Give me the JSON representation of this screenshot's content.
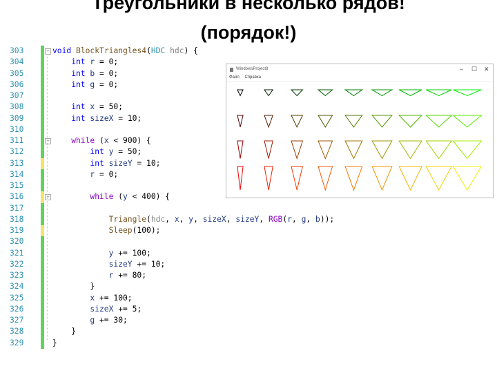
{
  "slide": {
    "title_line1": "Треугольники в несколько рядов!",
    "title_line2": "(порядок!)"
  },
  "editor": {
    "lines": [
      {
        "n": "303",
        "mark": "green",
        "fold": true,
        "indent": 0,
        "tokens": [
          [
            "void",
            "kw"
          ],
          [
            " ",
            "pl"
          ],
          [
            "BlockTriangles4",
            "fn"
          ],
          [
            "(",
            "pl"
          ],
          [
            "HDC",
            "ty"
          ],
          [
            " ",
            "pl"
          ],
          [
            "hdc",
            "par"
          ],
          [
            ") {",
            "pl"
          ]
        ]
      },
      {
        "n": "304",
        "mark": "green",
        "indent": 4,
        "tokens": [
          [
            "int",
            "kw"
          ],
          [
            " ",
            "pl"
          ],
          [
            "r",
            "var"
          ],
          [
            " = 0;",
            "pl"
          ]
        ]
      },
      {
        "n": "305",
        "mark": "green",
        "indent": 4,
        "tokens": [
          [
            "int",
            "kw"
          ],
          [
            " ",
            "pl"
          ],
          [
            "b",
            "var"
          ],
          [
            " = 0;",
            "pl"
          ]
        ]
      },
      {
        "n": "306",
        "mark": "green",
        "indent": 4,
        "tokens": [
          [
            "int",
            "kw"
          ],
          [
            " ",
            "pl"
          ],
          [
            "g",
            "var"
          ],
          [
            " = 0;",
            "pl"
          ]
        ]
      },
      {
        "n": "307",
        "mark": "green",
        "indent": 0,
        "tokens": []
      },
      {
        "n": "308",
        "mark": "green",
        "indent": 4,
        "tokens": [
          [
            "int",
            "kw"
          ],
          [
            " ",
            "pl"
          ],
          [
            "x",
            "var"
          ],
          [
            " = 50;",
            "pl"
          ]
        ]
      },
      {
        "n": "309",
        "mark": "green",
        "indent": 4,
        "tokens": [
          [
            "int",
            "kw"
          ],
          [
            " ",
            "pl"
          ],
          [
            "sizeX",
            "var"
          ],
          [
            " = 10;",
            "pl"
          ]
        ]
      },
      {
        "n": "310",
        "mark": "green",
        "indent": 0,
        "tokens": []
      },
      {
        "n": "311",
        "mark": "green",
        "fold": true,
        "indent": 4,
        "tokens": [
          [
            "while",
            "ctl"
          ],
          [
            " (",
            "pl"
          ],
          [
            "x",
            "var"
          ],
          [
            " < 900) {",
            "pl"
          ]
        ]
      },
      {
        "n": "312",
        "mark": "green",
        "indent": 8,
        "tokens": [
          [
            "int",
            "kw"
          ],
          [
            " ",
            "pl"
          ],
          [
            "y",
            "var"
          ],
          [
            " = 50;",
            "pl"
          ]
        ]
      },
      {
        "n": "313",
        "mark": "yellow",
        "indent": 8,
        "tokens": [
          [
            "int",
            "kw"
          ],
          [
            " ",
            "pl"
          ],
          [
            "sizeY",
            "var"
          ],
          [
            " = 10;",
            "pl"
          ]
        ]
      },
      {
        "n": "314",
        "mark": "green",
        "indent": 8,
        "tokens": [
          [
            "r",
            "var"
          ],
          [
            " = 0;",
            "pl"
          ]
        ]
      },
      {
        "n": "315",
        "mark": "green",
        "indent": 0,
        "tokens": []
      },
      {
        "n": "316",
        "mark": "yellow",
        "fold": true,
        "indent": 8,
        "tokens": [
          [
            "while",
            "ctl"
          ],
          [
            " (",
            "pl"
          ],
          [
            "y",
            "var"
          ],
          [
            " < 400) {",
            "pl"
          ]
        ]
      },
      {
        "n": "317",
        "mark": "green",
        "indent": 0,
        "tokens": []
      },
      {
        "n": "318",
        "mark": "green",
        "indent": 12,
        "tokens": [
          [
            "Triangle",
            "fn"
          ],
          [
            "(",
            "pl"
          ],
          [
            "hdc",
            "par"
          ],
          [
            ", ",
            "pl"
          ],
          [
            "x",
            "var"
          ],
          [
            ", ",
            "pl"
          ],
          [
            "y",
            "var"
          ],
          [
            ", ",
            "pl"
          ],
          [
            "sizeX",
            "var"
          ],
          [
            ", ",
            "pl"
          ],
          [
            "sizeY",
            "var"
          ],
          [
            ", ",
            "pl"
          ],
          [
            "RGB",
            "ctl"
          ],
          [
            "(",
            "pl"
          ],
          [
            "r",
            "var"
          ],
          [
            ", ",
            "pl"
          ],
          [
            "g",
            "var"
          ],
          [
            ", ",
            "pl"
          ],
          [
            "b",
            "var"
          ],
          [
            "));",
            "pl"
          ]
        ]
      },
      {
        "n": "319",
        "mark": "yellow",
        "indent": 12,
        "tokens": [
          [
            "Sleep",
            "fn"
          ],
          [
            "(100);",
            "pl"
          ]
        ]
      },
      {
        "n": "320",
        "mark": "green",
        "indent": 0,
        "tokens": []
      },
      {
        "n": "321",
        "mark": "green",
        "indent": 12,
        "tokens": [
          [
            "y",
            "var"
          ],
          [
            " += 100;",
            "pl"
          ]
        ]
      },
      {
        "n": "322",
        "mark": "green",
        "indent": 12,
        "tokens": [
          [
            "sizeY",
            "var"
          ],
          [
            " += 10;",
            "pl"
          ]
        ]
      },
      {
        "n": "323",
        "mark": "green",
        "indent": 12,
        "tokens": [
          [
            "r",
            "var"
          ],
          [
            " += 80;",
            "pl"
          ]
        ]
      },
      {
        "n": "324",
        "mark": "green",
        "indent": 8,
        "tokens": [
          [
            "}",
            "pl"
          ]
        ]
      },
      {
        "n": "325",
        "mark": "green",
        "indent": 8,
        "tokens": [
          [
            "x",
            "var"
          ],
          [
            " += 100;",
            "pl"
          ]
        ]
      },
      {
        "n": "326",
        "mark": "green",
        "indent": 8,
        "tokens": [
          [
            "sizeX",
            "var"
          ],
          [
            " += 5;",
            "pl"
          ]
        ]
      },
      {
        "n": "327",
        "mark": "green",
        "indent": 8,
        "tokens": [
          [
            "g",
            "var"
          ],
          [
            " += 30;",
            "pl"
          ]
        ]
      },
      {
        "n": "328",
        "mark": "green",
        "indent": 4,
        "tokens": [
          [
            "}",
            "pl"
          ]
        ]
      },
      {
        "n": "329",
        "mark": "green",
        "indent": 0,
        "tokens": [
          [
            "}",
            "pl"
          ]
        ]
      }
    ]
  },
  "window": {
    "title": "WindowsProject8",
    "menu": [
      "Файл",
      "Справка"
    ],
    "minimize_icon": "minimize-icon",
    "maximize_icon": "maximize-icon",
    "close_icon": "close-icon",
    "minimize": "–",
    "maximize": "☐",
    "close": "✕",
    "triangle_grid": {
      "columns": 9,
      "rows": 4
    }
  }
}
